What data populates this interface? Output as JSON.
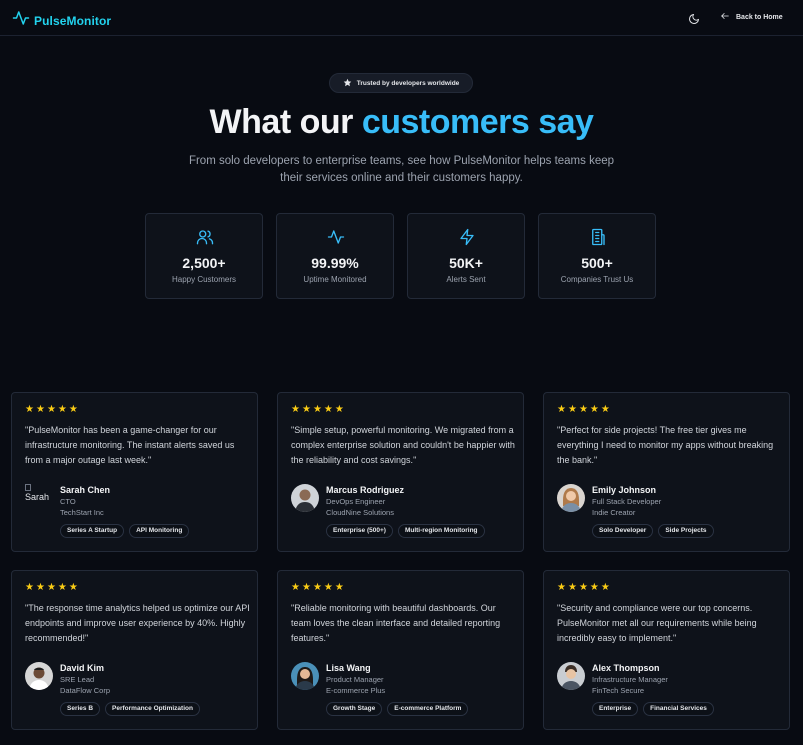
{
  "header": {
    "brand": "PulseMonitor",
    "back_label": "Back to Home"
  },
  "hero": {
    "badge": "Trusted by developers worldwide",
    "title_main": "What our ",
    "title_accent": "customers say",
    "subtitle": "From solo developers to enterprise teams, see how PulseMonitor helps teams keep their services online and their customers happy."
  },
  "stats": [
    {
      "icon": "users-icon",
      "value": "2,500+",
      "label": "Happy Customers"
    },
    {
      "icon": "activity-icon",
      "value": "99.99%",
      "label": "Uptime Monitored"
    },
    {
      "icon": "zap-icon",
      "value": "50K+",
      "label": "Alerts Sent"
    },
    {
      "icon": "building-icon",
      "value": "500+",
      "label": "Companies Trust Us"
    }
  ],
  "testimonials": [
    {
      "rating": 5,
      "quote": "\"PulseMonitor has been a game-changer for our infrastructure monitoring. The instant alerts saved us from a major outage last week.\"",
      "avatar_alt": "Sarah",
      "name": "Sarah Chen",
      "role": "CTO",
      "company": "TechStart Inc",
      "tags": [
        "Series A Startup",
        "API Monitoring"
      ]
    },
    {
      "rating": 5,
      "quote": "\"Simple setup, powerful monitoring. We migrated from a complex enterprise solution and couldn't be happier with the reliability and cost savings.\"",
      "name": "Marcus Rodriguez",
      "role": "DevOps Engineer",
      "company": "CloudNine Solutions",
      "tags": [
        "Enterprise (500+)",
        "Multi-region Monitoring"
      ]
    },
    {
      "rating": 5,
      "quote": "\"Perfect for side projects! The free tier gives me everything I need to monitor my apps without breaking the bank.\"",
      "name": "Emily Johnson",
      "role": "Full Stack Developer",
      "company": "Indie Creator",
      "tags": [
        "Solo Developer",
        "Side Projects"
      ]
    },
    {
      "rating": 5,
      "quote": "\"The response time analytics helped us optimize our API endpoints and improve user experience by 40%. Highly recommended!\"",
      "name": "David Kim",
      "role": "SRE Lead",
      "company": "DataFlow Corp",
      "tags": [
        "Series B",
        "Performance Optimization"
      ]
    },
    {
      "rating": 5,
      "quote": "\"Reliable monitoring with beautiful dashboards. Our team loves the clean interface and detailed reporting features.\"",
      "name": "Lisa Wang",
      "role": "Product Manager",
      "company": "E-commerce Plus",
      "tags": [
        "Growth Stage",
        "E-commerce Platform"
      ]
    },
    {
      "rating": 5,
      "quote": "\"Security and compliance were our top concerns. PulseMonitor met all our requirements while being incredibly easy to implement.\"",
      "name": "Alex Thompson",
      "role": "Infrastructure Manager",
      "company": "FinTech Secure",
      "tags": [
        "Enterprise",
        "Financial Services"
      ]
    }
  ],
  "colors": {
    "background": "#080b12",
    "card": "#0e121a",
    "border": "#232a38",
    "accent": "#38bdf8",
    "brand": "#22d3ee",
    "star": "#facc15"
  }
}
